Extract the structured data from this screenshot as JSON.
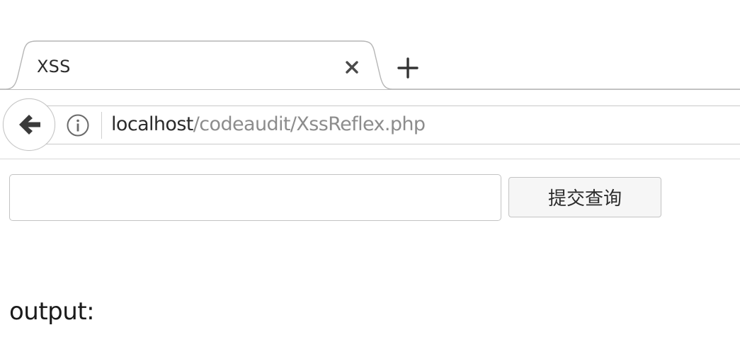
{
  "tab": {
    "title": "XSS"
  },
  "url": {
    "host": "localhost",
    "path": "/codeaudit/XssReflex.php"
  },
  "form": {
    "query_value": "",
    "submit_label": "提交查询"
  },
  "output": {
    "label": "output:"
  },
  "icons": {
    "back": "back-arrow-icon",
    "info": "info-icon",
    "close": "close-icon",
    "new_tab": "plus-icon"
  }
}
